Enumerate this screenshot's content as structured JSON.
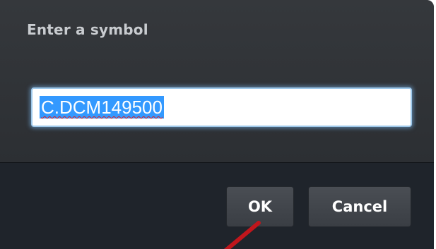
{
  "dialog": {
    "title": "Enter a symbol",
    "symbol_input": {
      "value": "C.DCM149500",
      "selected": true
    },
    "buttons": {
      "ok_label": "OK",
      "cancel_label": "Cancel"
    }
  },
  "colors": {
    "dialog_background": "#2f3236",
    "footer_background": "#1f242b",
    "selection_highlight": "#3399ff",
    "annotation_arrow": "#c0161c"
  }
}
